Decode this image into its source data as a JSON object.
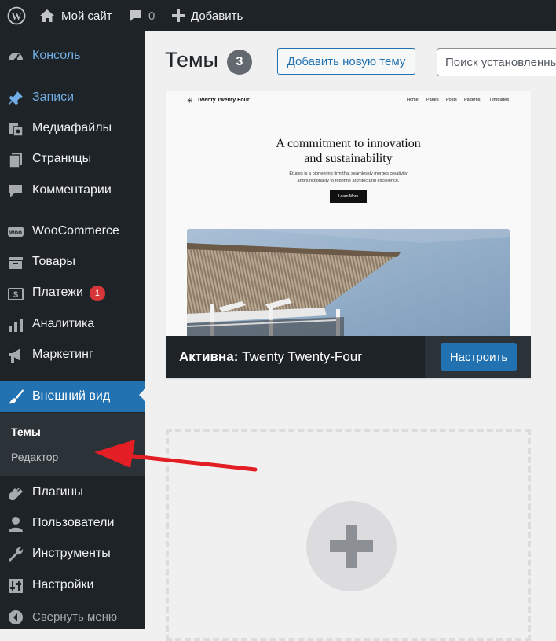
{
  "admin_bar": {
    "site_name": "Мой сайт",
    "comments_count": "0",
    "add_new": "Добавить"
  },
  "sidebar": {
    "items": [
      {
        "label": "Консоль",
        "icon": "dashboard-icon"
      },
      {
        "label": "Записи",
        "icon": "pin-icon"
      },
      {
        "label": "Медиафайлы",
        "icon": "media-icon"
      },
      {
        "label": "Страницы",
        "icon": "pages-icon"
      },
      {
        "label": "Комментарии",
        "icon": "comments-icon"
      },
      {
        "label": "WooCommerce",
        "icon": "woo-icon"
      },
      {
        "label": "Товары",
        "icon": "products-icon"
      },
      {
        "label": "Платежи",
        "icon": "payments-icon",
        "badge": "1"
      },
      {
        "label": "Аналитика",
        "icon": "analytics-icon"
      },
      {
        "label": "Маркетинг",
        "icon": "marketing-icon"
      },
      {
        "label": "Внешний вид",
        "icon": "appearance-icon",
        "current": true
      },
      {
        "label": "Плагины",
        "icon": "plugins-icon"
      },
      {
        "label": "Пользователи",
        "icon": "users-icon"
      },
      {
        "label": "Инструменты",
        "icon": "tools-icon"
      },
      {
        "label": "Настройки",
        "icon": "settings-icon"
      },
      {
        "label": "Свернуть меню",
        "icon": "collapse-icon"
      }
    ],
    "submenu": [
      {
        "label": "Темы",
        "active": true
      },
      {
        "label": "Редактор",
        "active": false
      }
    ]
  },
  "main": {
    "title": "Темы",
    "theme_count": "3",
    "add_theme_button": "Добавить новую тему",
    "search_placeholder": "Поиск установленных тем..."
  },
  "active_theme": {
    "active_prefix": "Активна:",
    "name": "Twenty Twenty-Four",
    "customize_button": "Настроить",
    "preview": {
      "site_title": "Twenty Twenty Four",
      "nav": [
        "Home",
        "Pages",
        "Posts",
        "Patterns",
        "Templates"
      ],
      "heading_line1": "A commitment to innovation",
      "heading_line2": "and sustainability",
      "body_line1": "Études is a pioneering firm that seamlessly merges creativity",
      "body_line2": "and functionality to redefine architectural excellence.",
      "button": "Learn More"
    }
  },
  "colors": {
    "admin_dark": "#1d2327",
    "accent_blue": "#2271b1",
    "badge_red": "#d63638",
    "annotation_red": "#e31e24"
  }
}
